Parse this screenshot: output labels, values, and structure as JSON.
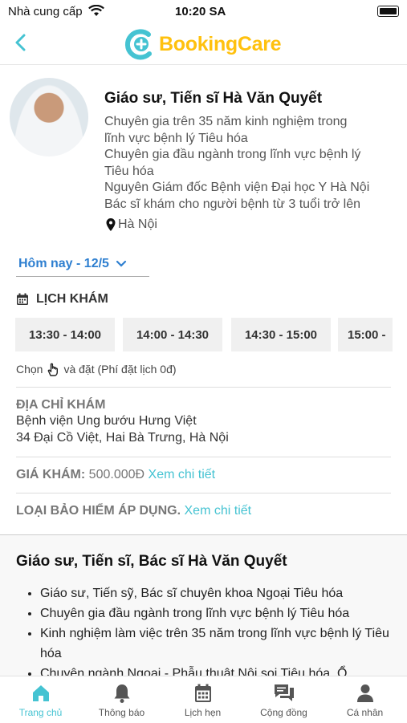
{
  "status_bar": {
    "carrier": "Nhà cung cấp",
    "time": "10:20 SA"
  },
  "header": {
    "logo_text": "BookingCare"
  },
  "doctor": {
    "name": "Giáo sư, Tiến sĩ Hà Văn Quyết",
    "description": [
      "Chuyên gia trên 35 năm kinh nghiệm trong",
      "lĩnh vực bệnh lý Tiêu hóa",
      "Chuyên gia đầu ngành trong lĩnh vực bệnh lý",
      "Tiêu hóa",
      "Nguyên Giám đốc Bệnh viện Đại học Y Hà Nội",
      "Bác sĩ khám cho người bệnh từ 3 tuổi trở lên"
    ],
    "location": "Hà Nội"
  },
  "date_select": {
    "value": "Hôm nay - 12/5"
  },
  "schedule": {
    "title": "LỊCH KHÁM",
    "slots": [
      "13:30 - 14:00",
      "14:00 - 14:30",
      "14:30 - 15:00",
      "15:00 -"
    ],
    "hint_before": "Chọn",
    "hint_after": "và đặt (Phí đặt lịch 0đ)"
  },
  "address": {
    "label": "ĐỊA CHỈ KHÁM",
    "name": "Bệnh viện Ung bướu Hưng Việt",
    "street": "34 Đại Cồ Việt, Hai Bà Trưng, Hà Nội"
  },
  "price": {
    "label": "GIÁ KHÁM:",
    "value": "500.000Đ",
    "link": "Xem chi tiết"
  },
  "insurance": {
    "label": "LOẠI BẢO HIỂM ÁP DỤNG.",
    "link": "Xem chi tiết"
  },
  "intro": {
    "title": "Giáo sư, Tiến sĩ, Bác sĩ Hà Văn Quyết",
    "items": [
      "Giáo sư, Tiến sỹ, Bác sĩ chuyên khoa Ngoại Tiêu hóa",
      "Chuyên gia đầu ngành trong lĩnh vực bệnh lý Tiêu hóa",
      "Kinh nghiệm làm việc trên 35 năm trong lĩnh vực bệnh lý Tiêu hóa",
      "Chuyên ngành Ngoại - Phẫu thuật Nội soi Tiêu hóa, Ổ"
    ]
  },
  "tabbar": {
    "tabs": [
      {
        "label": "Trang chủ",
        "icon": "home-icon"
      },
      {
        "label": "Thông báo",
        "icon": "bell-icon"
      },
      {
        "label": "Lịch hẹn",
        "icon": "calendar-icon"
      },
      {
        "label": "Cộng đồng",
        "icon": "chat-icon"
      },
      {
        "label": "Cá nhân",
        "icon": "person-icon"
      }
    ]
  },
  "colors": {
    "accent": "#45c3d2",
    "logo_yellow": "#ffc10e",
    "date_blue": "#2e7fd0"
  }
}
